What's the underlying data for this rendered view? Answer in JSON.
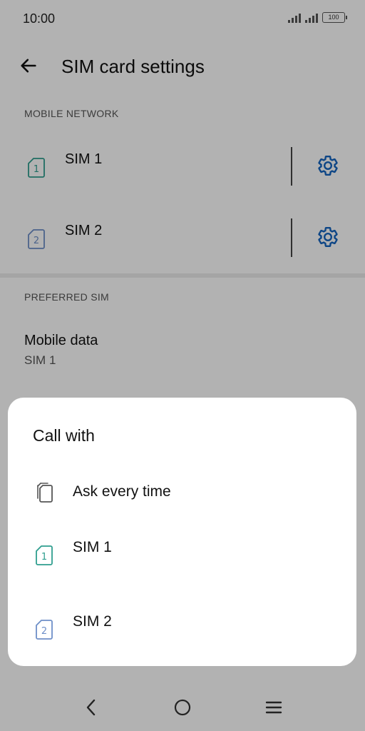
{
  "status_bar": {
    "time": "10:00",
    "battery": "100"
  },
  "header": {
    "back_icon": "arrow-left-icon",
    "title": "SIM card settings"
  },
  "mobile_network": {
    "header": "MOBILE NETWORK",
    "sims": [
      {
        "label": "SIM 1",
        "number": "1",
        "color": "#2f9e8f",
        "settings_icon": "gear-icon"
      },
      {
        "label": "SIM 2",
        "number": "2",
        "color": "#6e8fc8",
        "settings_icon": "gear-icon"
      }
    ]
  },
  "preferred_sim": {
    "header": "PREFERRED SIM",
    "mobile_data": {
      "title": "Mobile data",
      "value": "SIM 1"
    }
  },
  "dialog": {
    "title": "Call with",
    "options": [
      {
        "label": "Ask every time",
        "icon": "dual-sim-icon"
      },
      {
        "label": "SIM 1",
        "number": "1",
        "icon": "sim-1-icon"
      },
      {
        "label": "SIM 2",
        "number": "2",
        "icon": "sim-2-icon"
      }
    ]
  },
  "nav_bar": {
    "back_icon": "nav-back-icon",
    "home_icon": "nav-home-icon",
    "recents_icon": "nav-menu-icon"
  },
  "colors": {
    "accent": "#1565c0",
    "sim1": "#2f9e8f",
    "sim2": "#6e8fc8",
    "scrim": "rgba(0,0,0,0.30)"
  }
}
